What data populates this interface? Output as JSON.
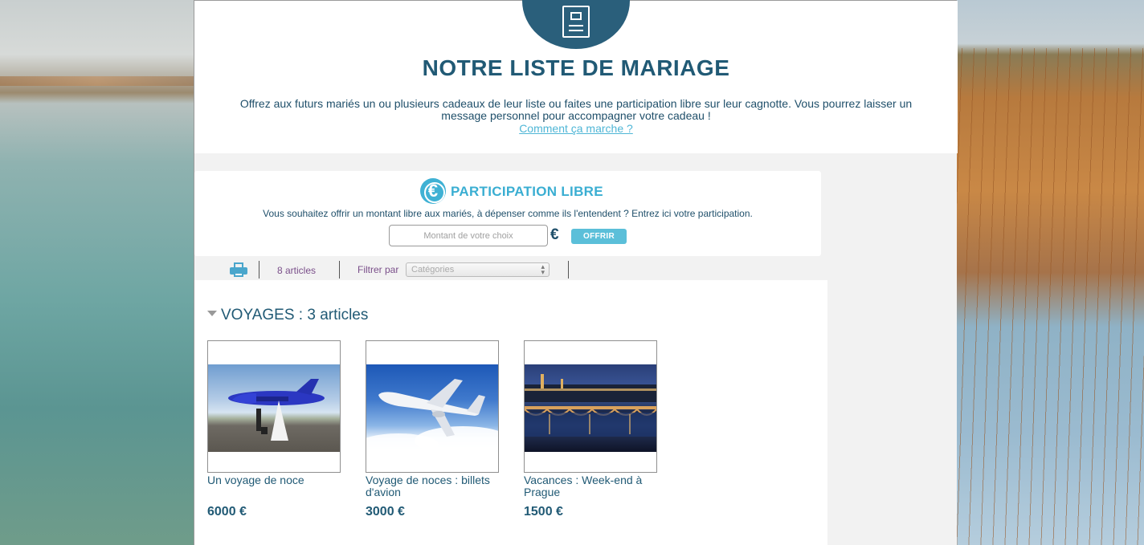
{
  "header": {
    "title": "NOTRE LISTE DE MARIAGE",
    "intro": "Offrez aux futurs mariés un ou plusieurs cadeaux de leur liste ou faites une participation libre sur leur cagnotte. Vous pourrez laisser un message personnel pour accompagner votre cadeau !",
    "how_link": "Comment ça marche ?"
  },
  "participation": {
    "icon": "euro-icon",
    "title": "PARTICIPATION LIBRE",
    "description": "Vous souhaitez offrir un montant libre aux mariés, à dépenser comme ils l'entendent ? Entrez ici votre participation.",
    "amount_placeholder": "Montant de votre choix",
    "currency": "€",
    "offer_label": "OFFRIR"
  },
  "toolbar": {
    "print_icon": "print-icon",
    "count_label": "8 articles",
    "filter_label": "Filtrer par",
    "filter_selected": "Catégories"
  },
  "section": {
    "title": "VOYAGES : 3 articles",
    "products": [
      {
        "name": "Un voyage de noce",
        "price": "6000 €"
      },
      {
        "name": "Voyage de noces : billets d'avion",
        "price": "3000 €"
      },
      {
        "name": "Vacances : Week-end à Prague",
        "price": "1500 €"
      }
    ]
  },
  "colors": {
    "primary": "#215a75",
    "accent": "#3aaed2",
    "button": "#5bbfd9"
  }
}
